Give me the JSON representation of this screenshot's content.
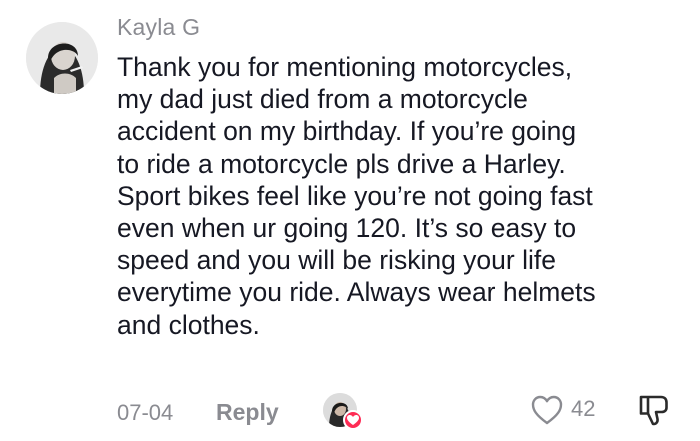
{
  "comment": {
    "username": "Kayla G",
    "avatar_icon": "user-avatar-photo",
    "text": "Thank you for mentioning motorcycles,\nmy dad just died from a motorcycle\naccident on my birthday. If you’re going\nto ride a motorcycle pls drive a Harley.\nSport bikes feel like you’re not going fast\neven when ur going 120. It’s so easy to\nspeed and you will be risking your life\neverytime you ride. Always wear helmets\nand clothes.",
    "date": "07-04",
    "reply_label": "Reply",
    "like_count": "42",
    "liked_by_creator": true,
    "icons": {
      "like": "heart-outline-icon",
      "dislike": "thumbs-down-icon",
      "creator_like": "heart-icon"
    },
    "colors": {
      "text": "#161823",
      "muted": "#8a8b91",
      "accent": "#fe2c55"
    }
  }
}
